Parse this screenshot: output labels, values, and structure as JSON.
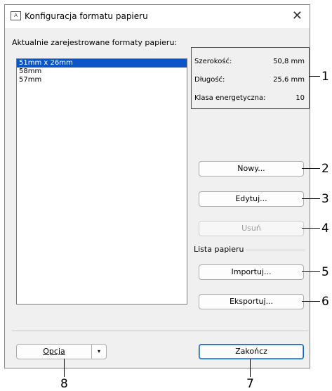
{
  "window": {
    "title": "Konfiguracja formatu papieru",
    "app_icon_text": "A"
  },
  "formats_label": "Aktualnie zarejestrowane formaty papieru:",
  "formats": [
    {
      "label": "51mm x 26mm",
      "selected": true
    },
    {
      "label": "58mm",
      "selected": false
    },
    {
      "label": "57mm",
      "selected": false
    }
  ],
  "info": {
    "width_label": "Szerokość:",
    "width_value": "50,8 mm",
    "length_label": "Długość:",
    "length_value": "25,6 mm",
    "energy_label": "Klasa energetyczna:",
    "energy_value": "10"
  },
  "buttons": {
    "new": "Nowy...",
    "edit": "Edytuj...",
    "delete": "Usuń",
    "import": "Importuj...",
    "export": "Eksportuj...",
    "option": "Opcja",
    "finish": "Zakończ"
  },
  "paper_list_label": "Lista papieru",
  "callouts": [
    "1",
    "2",
    "3",
    "4",
    "5",
    "6",
    "7",
    "8"
  ],
  "colors": {
    "selection": "#0a56c8",
    "primary_border": "#0f61c4"
  }
}
